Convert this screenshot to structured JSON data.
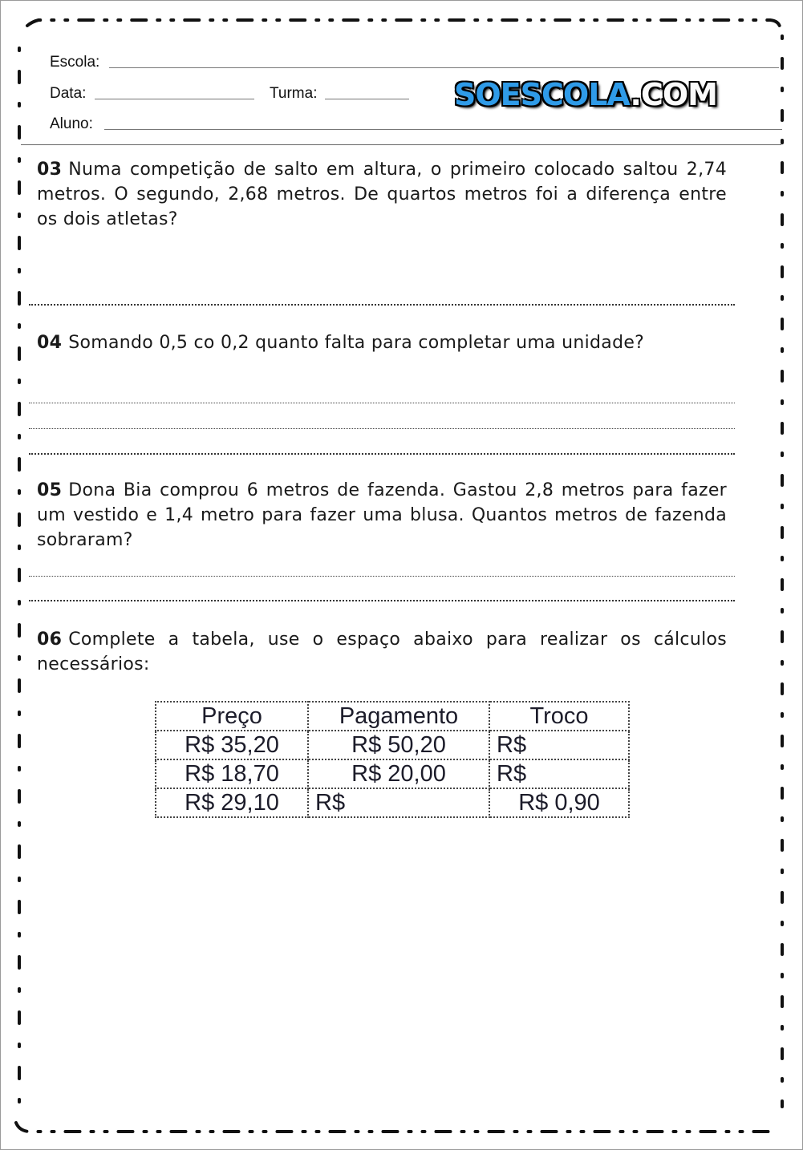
{
  "header": {
    "school_label": "Escola:",
    "date_label": "Data:",
    "class_label": "Turma:",
    "student_label": "Aluno:",
    "logo": {
      "main": "SOESCOLA",
      "suffix": ".COM",
      "main_color": "#2f9be8",
      "suffix_color": "#fafafa"
    }
  },
  "questions": [
    {
      "number": "03",
      "text": "Numa competição de salto em altura, o primeiro colocado saltou 2,74 metros. O segundo, 2,68 metros. De quartos metros foi a diferença entre os dois atletas?"
    },
    {
      "number": "04",
      "text": "Somando 0,5 co  0,2 quanto falta para completar uma unidade?"
    },
    {
      "number": "05",
      "text": "Dona Bia comprou 6 metros de fazenda. Gastou 2,8 metros para fazer um vestido e 1,4 metro para fazer uma blusa. Quantos metros de fazenda sobraram?"
    },
    {
      "number": "06",
      "text": "Complete a tabela, use o espaço abaixo para realizar os cálculos necessários:"
    }
  ],
  "table": {
    "headers": [
      "Preço",
      "Pagamento",
      "Troco"
    ],
    "rows": [
      [
        "R$ 35,20",
        "R$ 50,20",
        "R$"
      ],
      [
        "R$ 18,70",
        "R$ 20,00",
        "R$"
      ],
      [
        "R$ 29,10",
        "R$",
        "R$ 0,90"
      ]
    ]
  }
}
